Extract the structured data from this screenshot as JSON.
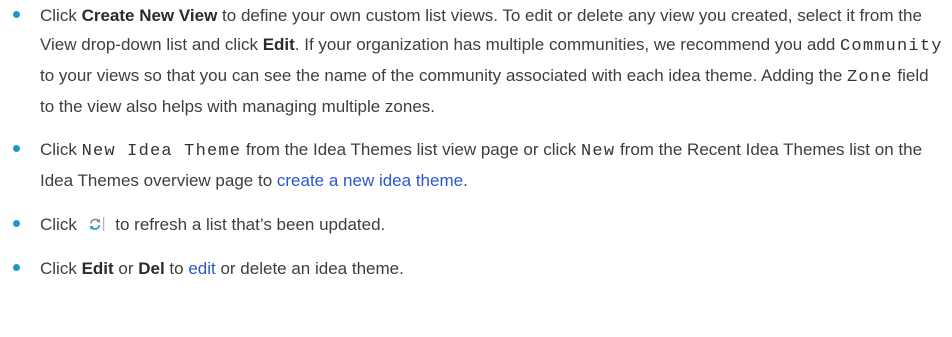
{
  "bullets": [
    {
      "t1": "Click ",
      "b1": "Create New View",
      "t2": " to define your own custom list views. To edit or delete any view you created, select it from the View drop-down list and click ",
      "b2": "Edit",
      "t3": ". If your organization has multiple communities, we recommend you add ",
      "m1": "Community",
      "t4": " to your views so that you can see the name of the community associated with each idea theme. Adding the ",
      "m2": "Zone",
      "t5": " field to the view also helps with managing multiple zones."
    },
    {
      "t1": "Click ",
      "m1": "New Idea Theme",
      "t2": " from the Idea Themes list view page or click ",
      "m2": "New",
      "t3": " from the Recent Idea Themes list on the Idea Themes overview page to ",
      "link": "create a new idea theme",
      "t4": "."
    },
    {
      "t1": "Click ",
      "icon": "refresh-icon",
      "t2": " to refresh a list that’s been updated."
    },
    {
      "t1": "Click ",
      "b1": "Edit",
      "t2": " or ",
      "b2": "Del",
      "t3": " to ",
      "link": "edit",
      "t4": " or delete an idea theme."
    }
  ],
  "colors": {
    "bullet": "#1b96d4",
    "link": "#2a55d4",
    "text": "#3e3e3c"
  }
}
